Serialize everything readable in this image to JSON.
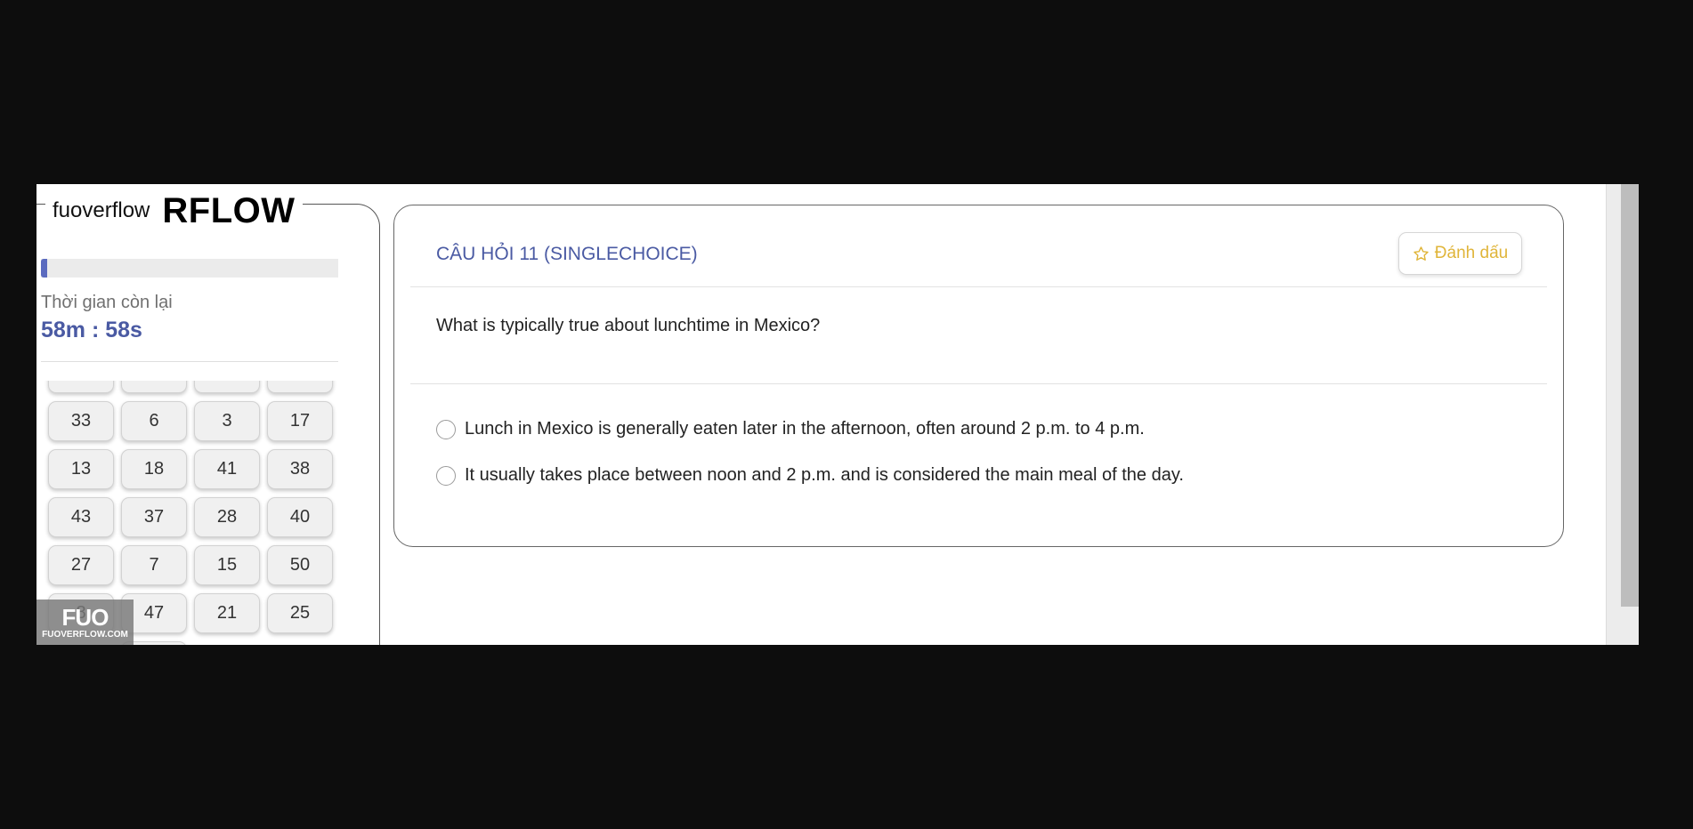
{
  "brand": {
    "name": "fuoverflow",
    "logo_text": "RFLOW"
  },
  "timer": {
    "label": "Thời gian còn lại",
    "value": "58m : 58s",
    "progress": 0.02
  },
  "question_grid": {
    "rows": [
      [
        "",
        "",
        "",
        ""
      ],
      [
        "33",
        "6",
        "3",
        "17"
      ],
      [
        "13",
        "18",
        "41",
        "38"
      ],
      [
        "43",
        "37",
        "28",
        "40"
      ],
      [
        "27",
        "7",
        "15",
        "50"
      ],
      [
        "8",
        "47",
        "21",
        "25"
      ]
    ]
  },
  "watermark": {
    "big": "FUO",
    "small": "FUOVERFLOW.COM"
  },
  "question": {
    "title": "CÂU HỎI 11 (SINGLECHOICE)",
    "bookmark_label": "Đánh dấu",
    "text": "What is typically true about lunchtime in Mexico?",
    "options": [
      "Lunch in Mexico is generally eaten later in the afternoon, often around 2 p.m. to 4 p.m.",
      "It usually takes place between noon and 2 p.m. and is considered the main meal of the day."
    ]
  },
  "colors": {
    "accent": "#4a5aa3",
    "bookmark": "#e0b53a",
    "progress": "#5b6bbf"
  },
  "icons": {
    "bookmark": "star-icon"
  }
}
